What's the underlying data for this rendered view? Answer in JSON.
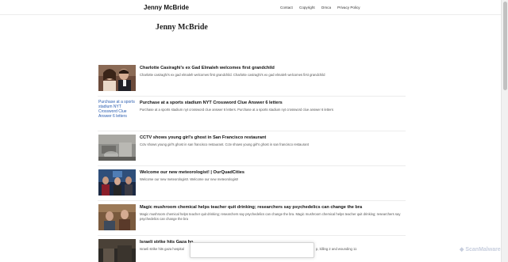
{
  "header": {
    "brand": "Jenny McBride",
    "nav": [
      "Contact",
      "Copyright",
      "Dmca",
      "Privacy Policy"
    ]
  },
  "page": {
    "title": "Jenny McBride"
  },
  "articles": [
    {
      "title": "Charlotte Casiraghi's ex Gad Elmaleh welcomes first grandchild",
      "desc": "Charlotte casiraghi's ex gad elmaleh welcomes first grandchild. Charlotte casiraghi's ex gad elmaleh welcomes first grandchild"
    },
    {
      "image_alt": "Purchase at a sports stadium NYT Crossword Clue Answer 6 letters",
      "title": "Purchase at a sports stadium NYT Crossword Clue Answer 6 letters",
      "desc": "Purchase at a sports stadium nyt crossword clue answer 6 letters. Purchase at a sports stadium nyt crossword clue answer 6 letters"
    },
    {
      "title": "CCTV shows young girl's ghost in San Francisco restaurant",
      "desc": "Cctv shows young girl's ghost in san francisco restaurant. Cctv shows young girl's ghost in san francisco restaurant"
    },
    {
      "title": "Welcome our new meteorologist! | OurQuadCities",
      "desc": "Welcome our new meteorologist!. Welcome our new meteorologist!"
    },
    {
      "title": "Magic mushroom chemical helps teacher quit drinking; researchers say psychedelics can change the bra",
      "desc": "Magic mushroom chemical helps teacher quit drinking; researchers say psychedelics can change the bra. Magic mushroom chemical helps teacher quit drinking; researchers say psychedelics can change the bra"
    },
    {
      "title": "Israeli strike hits Gaza ho",
      "desc": "Israeli strike hits gaza hospital",
      "desc_tail": "p, killing 2 and wounding 11"
    }
  ],
  "watermark": {
    "brand": "ScanMalware"
  }
}
